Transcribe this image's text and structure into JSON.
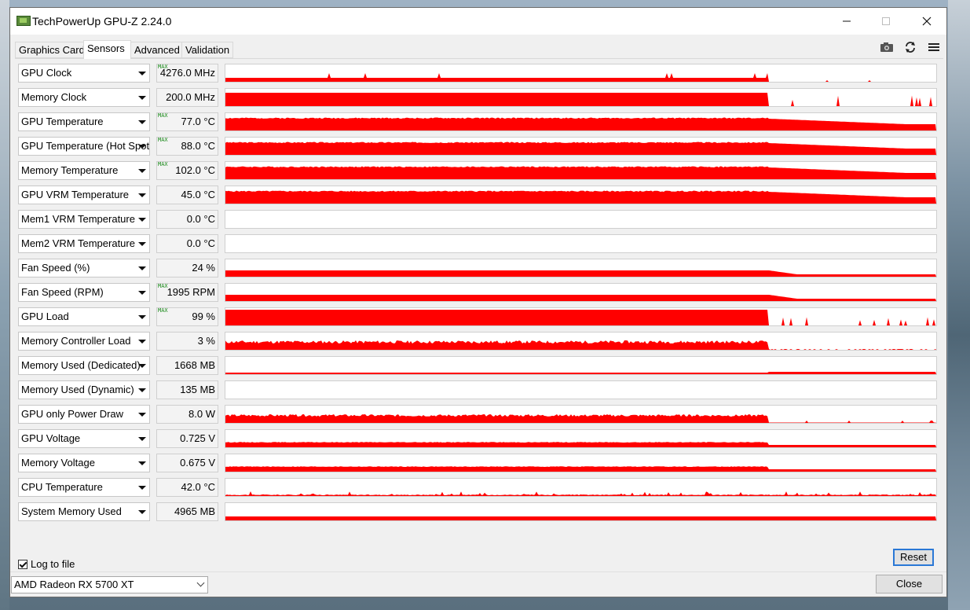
{
  "window": {
    "title": "TechPowerUp GPU-Z 2.24.0"
  },
  "tabs": [
    {
      "label": "Graphics Card",
      "active": false
    },
    {
      "label": "Sensors",
      "active": true
    },
    {
      "label": "Advanced",
      "active": false
    },
    {
      "label": "Validation",
      "active": false
    }
  ],
  "toolbar": {
    "icons": [
      "camera-icon",
      "refresh-icon",
      "menu-icon"
    ]
  },
  "graph_color": "#ff0000",
  "max_label": "MAX",
  "sensors": [
    {
      "name": "GPU Clock",
      "value": "4276.0 MHz",
      "max": true,
      "profile": "clock"
    },
    {
      "name": "Memory Clock",
      "value": "200.0 MHz",
      "max": false,
      "profile": "memclock"
    },
    {
      "name": "GPU Temperature",
      "value": "77.0 °C",
      "max": true,
      "profile": "temp"
    },
    {
      "name": "GPU Temperature (Hot Spot)",
      "value": "88.0 °C",
      "max": true,
      "profile": "temp"
    },
    {
      "name": "Memory Temperature",
      "value": "102.0 °C",
      "max": true,
      "profile": "temp"
    },
    {
      "name": "GPU VRM Temperature",
      "value": "45.0 °C",
      "max": false,
      "profile": "temp"
    },
    {
      "name": "Mem1 VRM Temperature",
      "value": "0.0 °C",
      "max": false,
      "profile": "none"
    },
    {
      "name": "Mem2 VRM Temperature",
      "value": "0.0 °C",
      "max": false,
      "profile": "none"
    },
    {
      "name": "Fan Speed (%)",
      "value": "24 %",
      "max": false,
      "profile": "fan"
    },
    {
      "name": "Fan Speed (RPM)",
      "value": "1995 RPM",
      "max": true,
      "profile": "fan"
    },
    {
      "name": "GPU Load",
      "value": "99 %",
      "max": true,
      "profile": "load"
    },
    {
      "name": "Memory Controller Load",
      "value": "3 %",
      "max": false,
      "profile": "mcload"
    },
    {
      "name": "Memory Used (Dedicated)",
      "value": "1668 MB",
      "max": false,
      "profile": "memused"
    },
    {
      "name": "Memory Used (Dynamic)",
      "value": "135 MB",
      "max": false,
      "profile": "none"
    },
    {
      "name": "GPU only Power Draw",
      "value": "8.0 W",
      "max": false,
      "profile": "power"
    },
    {
      "name": "GPU Voltage",
      "value": "0.725 V",
      "max": false,
      "profile": "voltage"
    },
    {
      "name": "Memory Voltage",
      "value": "0.675 V",
      "max": false,
      "profile": "voltage"
    },
    {
      "name": "CPU Temperature",
      "value": "42.0 °C",
      "max": false,
      "profile": "cpu"
    },
    {
      "name": "System Memory Used",
      "value": "4965 MB",
      "max": false,
      "profile": "sysmem"
    }
  ],
  "bottom": {
    "log_label": "Log to file",
    "log_checked": true,
    "reset_label": "Reset",
    "gpu_name": "AMD Radeon RX 5700 XT",
    "close_label": "Close"
  }
}
